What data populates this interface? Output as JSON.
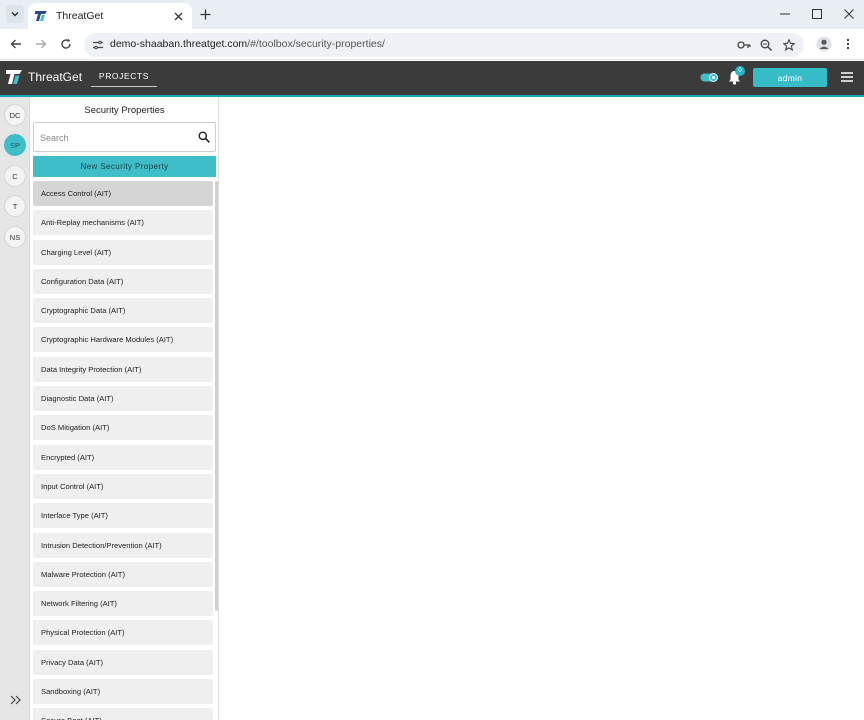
{
  "browser": {
    "tab_title": "ThreatGet",
    "url_host": "demo-shaaban.threatget.com",
    "url_path": "/#/toolbox/security-properties/"
  },
  "app": {
    "name": "ThreatGet",
    "nav_projects": "PROJECTS",
    "notification_count": "0",
    "user_button": "admin",
    "accent_color": "#3fbdc8",
    "header_color": "#3b3b3b"
  },
  "rail": {
    "items": [
      {
        "label": "DC",
        "active": false
      },
      {
        "label": "SP",
        "active": true
      },
      {
        "label": "C",
        "active": false
      },
      {
        "label": "T",
        "active": false
      },
      {
        "label": "NS",
        "active": false
      }
    ]
  },
  "panel": {
    "title": "Security Properties",
    "search_placeholder": "Search",
    "new_button": "New Security Property",
    "items": [
      "Access Control (AIT)",
      "Anti-Replay mechanisms (AIT)",
      "Charging Level (AIT)",
      "Configuration Data (AIT)",
      "Cryptographic Data (AIT)",
      "Cryptographic Hardware Modules (AIT)",
      "Data Integrity Protection (AIT)",
      "Diagnostic Data (AIT)",
      "DoS Mitigation (AIT)",
      "Encrypted (AIT)",
      "Input Control (AIT)",
      "Interface Type (AIT)",
      "Intrusion Detection/Prevention (AIT)",
      "Malware Protection (AIT)",
      "Network Filtering (AIT)",
      "Physical Protection (AIT)",
      "Privacy Data (AIT)",
      "Sandboxing (AIT)",
      "Secure Boot (AIT)"
    ],
    "selected_index": 0
  }
}
